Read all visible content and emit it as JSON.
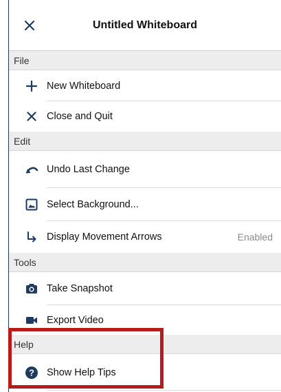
{
  "header": {
    "title": "Untitled Whiteboard",
    "close_icon": "close-icon"
  },
  "sections": {
    "file": "File",
    "edit": "Edit",
    "tools": "Tools",
    "help": "Help"
  },
  "items": {
    "new_whiteboard": {
      "label": "New Whiteboard",
      "icon": "plus-icon"
    },
    "close_quit": {
      "label": "Close and Quit",
      "icon": "x-icon"
    },
    "undo": {
      "label": "Undo Last Change",
      "icon": "undo-icon"
    },
    "select_background": {
      "label": "Select Background...",
      "icon": "image-icon"
    },
    "movement_arrows": {
      "label": "Display Movement Arrows",
      "icon": "arrow-down-right-icon",
      "value": "Enabled"
    },
    "take_snapshot": {
      "label": "Take Snapshot",
      "icon": "camera-icon"
    },
    "export_video": {
      "label": "Export Video",
      "icon": "video-camera-icon"
    },
    "help_tips": {
      "label": "Show Help Tips",
      "icon": "help-circle-icon"
    }
  },
  "colors": {
    "accent_dark": "#1f3a5f",
    "highlight_red": "#b71c1c",
    "section_bg": "#ededed"
  }
}
